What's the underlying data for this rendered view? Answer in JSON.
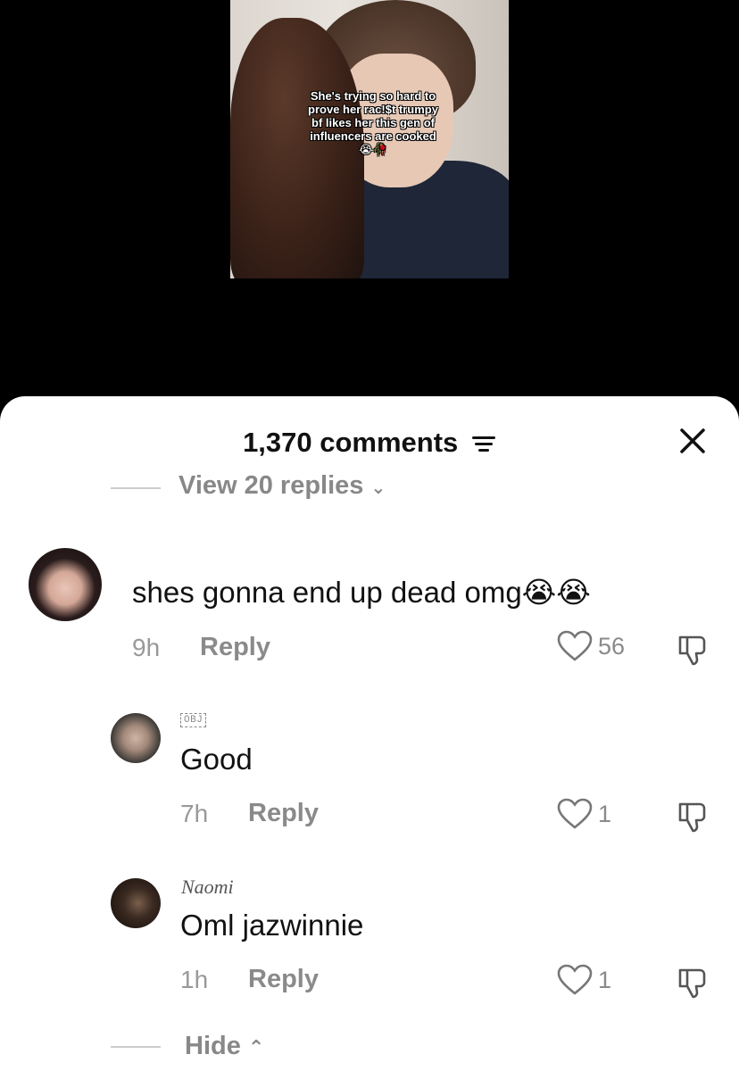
{
  "video": {
    "caption": "She's trying so hard to prove her rac!$t trumpy bf likes her this gen of influencers are cooked 😭🥀"
  },
  "sheet": {
    "comment_count": "1,370 comments",
    "view_replies": "View 20 replies"
  },
  "comments": [
    {
      "text": "shes gonna end up dead omg😭😭",
      "time": "9h",
      "reply_label": "Reply",
      "likes": "56"
    },
    {
      "badge": "OBJ",
      "text": "Good",
      "time": "7h",
      "reply_label": "Reply",
      "likes": "1"
    },
    {
      "username": "Naomi",
      "text": "Oml jazwinnie",
      "time": "1h",
      "reply_label": "Reply",
      "likes": "1"
    }
  ],
  "hide_label": "Hide",
  "icons": {
    "filter": "filter-icon",
    "close": "close-icon",
    "heart": "heart-icon",
    "dislike": "thumbs-down-icon",
    "chevron_down": "chevron-down-icon",
    "chevron_up": "chevron-up-icon"
  }
}
